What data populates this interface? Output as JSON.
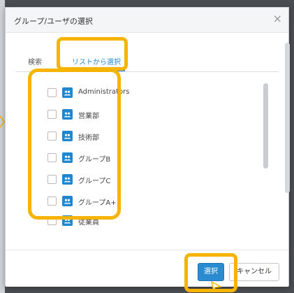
{
  "dialog": {
    "title": "グループ/ユーザの選択",
    "close_icon": "close-icon"
  },
  "tabs": [
    {
      "label": "検索",
      "active": false
    },
    {
      "label": "リストから選択",
      "active": true
    }
  ],
  "groups": [
    {
      "label": "Administrators",
      "checked": false,
      "icon": "group-icon"
    },
    {
      "label": "営業部",
      "checked": false,
      "icon": "group-icon"
    },
    {
      "label": "技術部",
      "checked": false,
      "icon": "group-icon"
    },
    {
      "label": "グループB",
      "checked": false,
      "icon": "group-icon"
    },
    {
      "label": "グループC",
      "checked": false,
      "icon": "group-icon"
    },
    {
      "label": "グループA+",
      "checked": false,
      "icon": "group-icon"
    },
    {
      "label": "従業員",
      "checked": false,
      "icon": "group-icon"
    }
  ],
  "footer": {
    "select_label": "選択",
    "cancel_label": "キャンセル"
  },
  "colors": {
    "accent": "#2b8bd0",
    "highlight": "#f6b400",
    "backdrop": "#4a4d52"
  }
}
